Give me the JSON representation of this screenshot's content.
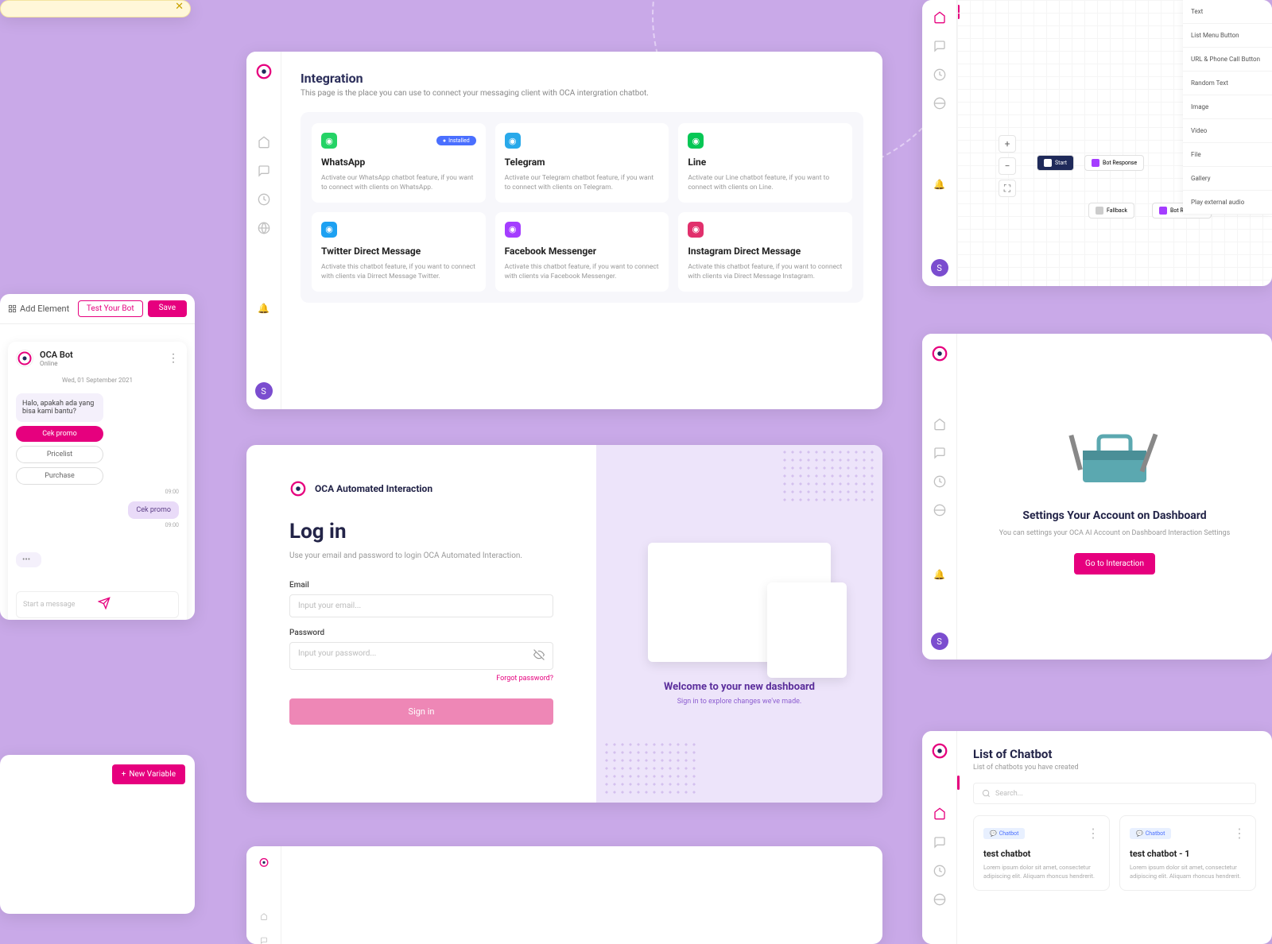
{
  "chat": {
    "add_element": "Add Element",
    "test_bot": "Test Your Bot",
    "save": "Save",
    "bot_name": "OCA Bot",
    "status": "Online",
    "date": "Wed, 01 September 2021",
    "greeting": "Halo, apakah ada yang bisa kami bantu?",
    "btn_promo": "Cek promo",
    "btn_pricelist": "Pricelist",
    "btn_purchase": "Purchase",
    "time1": "09:00",
    "reply": "Cek promo",
    "time2": "09:00",
    "input_ph": "Start a message"
  },
  "integration": {
    "title": "Integration",
    "subtitle": "This page is the place you can use to connect your messaging client with OCA intergration chatbot.",
    "installed": "Installed",
    "cards": [
      {
        "name": "WhatsApp",
        "desc": "Activate our WhatsApp chatbot feature, if you want to connect with clients on WhatsApp.",
        "color": "#25d366"
      },
      {
        "name": "Telegram",
        "desc": "Activate our Telegram chatbot feature, if you want to connect with clients on Telegram.",
        "color": "#29a9ea"
      },
      {
        "name": "Line",
        "desc": "Activate our Line chatbot feature, if you want to connect with clients on Line.",
        "color": "#06c755"
      },
      {
        "name": "Twitter Direct Message",
        "desc": "Activate this chatbot feature, if you want to connect with clients via Dirrect Message Twitter.",
        "color": "#1da1f2"
      },
      {
        "name": "Facebook Messenger",
        "desc": "Activate this chatbot feature, if you want to connect with clients via Facebook Messenger.",
        "color": "#a43dff"
      },
      {
        "name": "Instagram Direct Message",
        "desc": "Activate this chatbot feature, if you want to connect with clients via Direct Message Instagram.",
        "color": "#e1306c"
      }
    ]
  },
  "login": {
    "brand": "OCA Automated Interaction",
    "title": "Log in",
    "subtitle": "Use your email and password to login OCA Automated Interaction.",
    "email_label": "Email",
    "email_ph": "Input your email...",
    "password_label": "Password",
    "password_ph": "Input your password...",
    "forgot": "Forgot password?",
    "signin": "Sign in",
    "welcome_title": "Welcome to your new dashboard",
    "welcome_sub": "Sign in to explore changes we've made."
  },
  "newvar": {
    "label": "New Variable"
  },
  "flow": {
    "menu": [
      "Text",
      "List Menu Button",
      "URL & Phone Call Button",
      "Random Text",
      "Image",
      "Video",
      "File",
      "Gallery",
      "Play external audio"
    ],
    "nodes": {
      "start": "Start",
      "resp": "Bot Response",
      "fallback": "Fallback",
      "resp2": "Bot Response"
    }
  },
  "settings": {
    "title": "Settings Your Account on Dashboard",
    "desc": "You can settings your OCA AI Account on Dashboard Interaction Settings",
    "btn": "Go to Interaction"
  },
  "list": {
    "title": "List of Chatbot",
    "subtitle": "List of chatbots you have created",
    "search_ph": "Search...",
    "tag": "Chatbot",
    "bots": [
      {
        "name": "test chatbot",
        "desc": "Lorem ipsum dolor sit amet, consectetur adipiscing elit. Aliquam rhoncus hendrerit."
      },
      {
        "name": "test chatbot - 1",
        "desc": "Lorem ipsum dolor sit amet, consectetur adipiscing elit. Aliquam rhoncus hendrerit."
      }
    ]
  },
  "user_initial": "S"
}
